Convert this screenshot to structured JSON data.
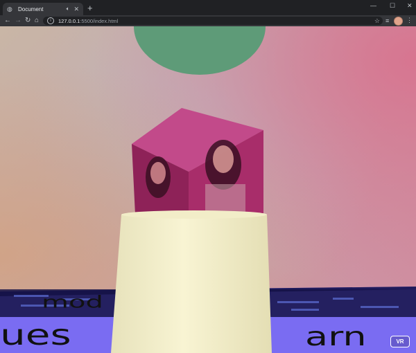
{
  "browser": {
    "tab_title": "Document",
    "new_tab_label": "+",
    "url_host": "127.0.0.1",
    "url_path": ":5500/index.html",
    "icons": {
      "favicon": "globe-icon",
      "audio": "speaker-icon",
      "close": "close-icon",
      "back": "back-arrow-icon",
      "forward": "forward-arrow-icon",
      "reload": "reload-icon",
      "home": "home-icon",
      "info": "info-icon",
      "star": "star-icon",
      "media": "media-control-icon",
      "menu": "kebab-menu-icon"
    }
  },
  "scene": {
    "vr_button_label": "VR",
    "floor_text_large_1": "mod",
    "floor_text_large_2": "ues",
    "floor_text_large_3": "arn",
    "colors": {
      "sphere": "#5e9b78",
      "cube": "#b43a78",
      "cylinder": "#f4efc8",
      "floor": "#7a6cf2"
    }
  }
}
